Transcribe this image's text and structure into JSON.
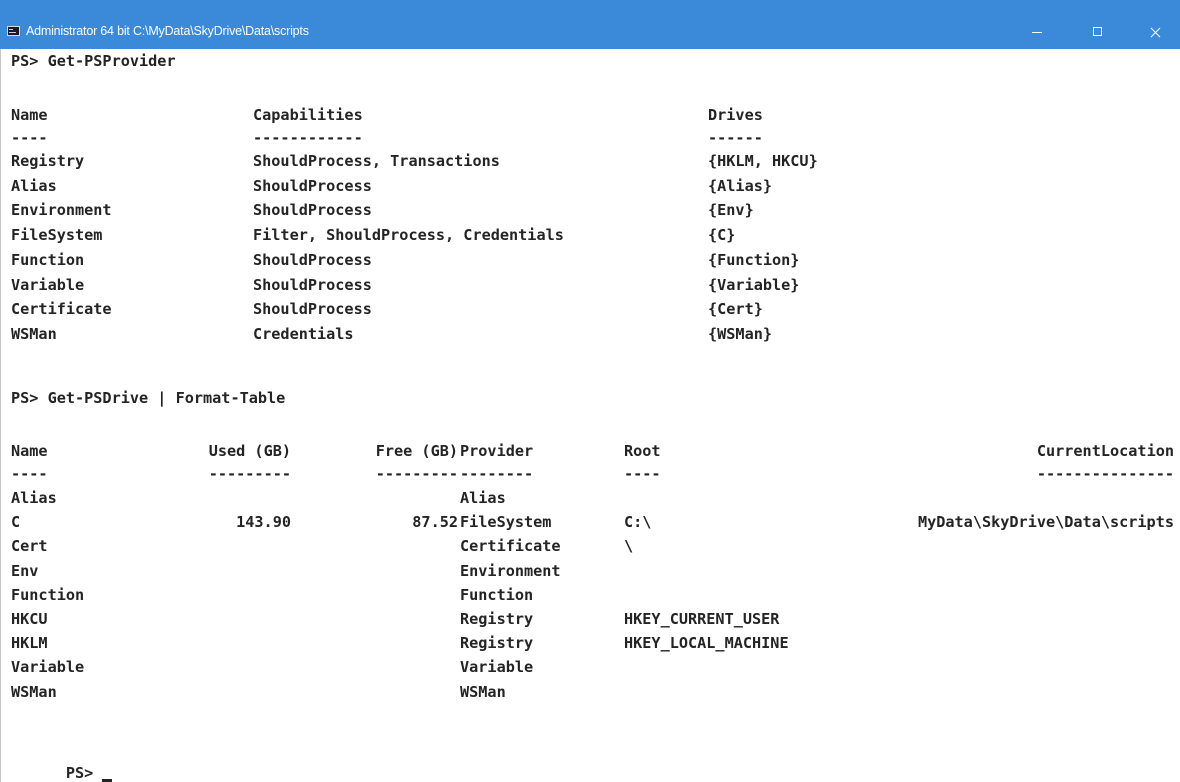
{
  "window": {
    "title": "Administrator 64 bit C:\\MyData\\SkyDrive\\Data\\scripts",
    "icon": "console-icon",
    "controls": [
      "minimize-icon",
      "maximize-icon",
      "close-icon"
    ],
    "colors": {
      "titlebar": "#3a8ad9",
      "background": "#ffffff",
      "text": "#242424"
    }
  },
  "console": {
    "cmd1": "PS> Get-PSProvider",
    "providers": {
      "headers": [
        "Name",
        "Capabilities",
        "Drives"
      ],
      "dashes": [
        "----",
        "------------",
        "------"
      ],
      "rows": [
        [
          "Registry",
          "ShouldProcess, Transactions",
          "{HKLM, HKCU}"
        ],
        [
          "Alias",
          "ShouldProcess",
          "{Alias}"
        ],
        [
          "Environment",
          "ShouldProcess",
          "{Env}"
        ],
        [
          "FileSystem",
          "Filter, ShouldProcess, Credentials",
          "{C}"
        ],
        [
          "Function",
          "ShouldProcess",
          "{Function}"
        ],
        [
          "Variable",
          "ShouldProcess",
          "{Variable}"
        ],
        [
          "Certificate",
          "ShouldProcess",
          "{Cert}"
        ],
        [
          "WSMan",
          "Credentials",
          "{WSMan}"
        ]
      ]
    },
    "cmd2": "PS> Get-PSDrive | Format-Table",
    "drives": {
      "headers": [
        "Name",
        "Used (GB)",
        "Free (GB)",
        "Provider",
        "Root",
        "CurrentLocation"
      ],
      "dashes": [
        "----",
        "---------",
        "---------",
        "--------",
        "----",
        "---------------"
      ],
      "rows": [
        [
          "Alias",
          "",
          "",
          "Alias",
          "",
          ""
        ],
        [
          "C",
          "143.90",
          "87.52",
          "FileSystem",
          "C:\\",
          "MyData\\SkyDrive\\Data\\scripts"
        ],
        [
          "Cert",
          "",
          "",
          "Certificate",
          "\\",
          ""
        ],
        [
          "Env",
          "",
          "",
          "Environment",
          "",
          ""
        ],
        [
          "Function",
          "",
          "",
          "Function",
          "",
          ""
        ],
        [
          "HKCU",
          "",
          "",
          "Registry",
          "HKEY_CURRENT_USER",
          ""
        ],
        [
          "HKLM",
          "",
          "",
          "Registry",
          "HKEY_LOCAL_MACHINE",
          ""
        ],
        [
          "Variable",
          "",
          "",
          "Variable",
          "",
          ""
        ],
        [
          "WSMan",
          "",
          "",
          "WSMan",
          "",
          ""
        ]
      ]
    },
    "prompt": "PS>"
  }
}
